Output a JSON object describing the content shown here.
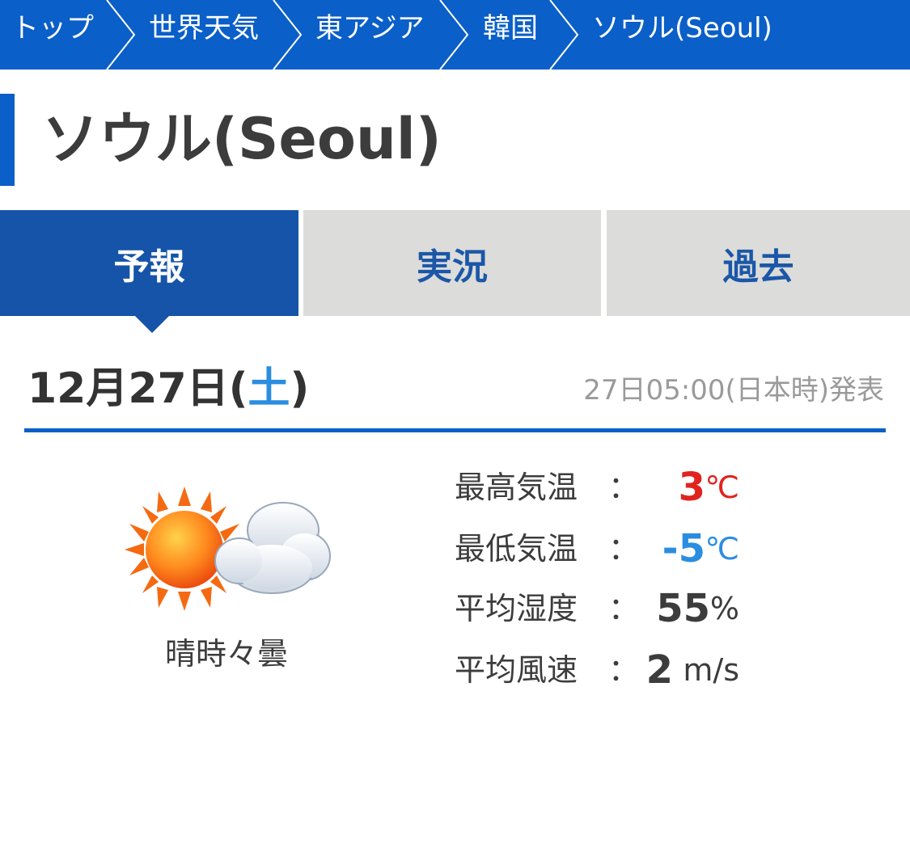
{
  "breadcrumb": {
    "items": [
      "トップ",
      "世界天気",
      "東アジア",
      "韓国",
      "ソウル(Seoul)"
    ]
  },
  "page": {
    "title": "ソウル(Seoul)"
  },
  "tabs": [
    {
      "label": "予報",
      "active": true
    },
    {
      "label": "実況",
      "active": false
    },
    {
      "label": "過去",
      "active": false
    }
  ],
  "forecast": {
    "date_prefix": "12月27日(",
    "weekday": "土",
    "date_suffix": ")",
    "published": "27日05:00(日本時)発表",
    "weather_icon": "sun-with-cloud-icon",
    "weather_label": "晴時々曇",
    "stats": [
      {
        "label": "最高気温",
        "colon": "：",
        "value": "3",
        "unit": "℃",
        "value_color": "#e0231f",
        "unit_color": "#e0231f"
      },
      {
        "label": "最低気温",
        "colon": "：",
        "value": "-5",
        "unit": "℃",
        "value_color": "#2a8de0",
        "unit_color": "#2a8de0"
      },
      {
        "label": "平均湿度",
        "colon": "：",
        "value": "55",
        "unit": "%",
        "value_color": "#3c3c3c",
        "unit_color": "#3c3c3c"
      },
      {
        "label": "平均風速",
        "colon": "：",
        "value": "2",
        "unit": "m/s",
        "value_color": "#3c3c3c",
        "unit_color": "#3c3c3c"
      }
    ]
  },
  "colors": {
    "brand_blue": "#0a5fc8",
    "tab_active": "#1554a8",
    "tab_inactive_bg": "#dcdcda",
    "high_temp": "#e0231f",
    "low_temp": "#2a8de0"
  }
}
